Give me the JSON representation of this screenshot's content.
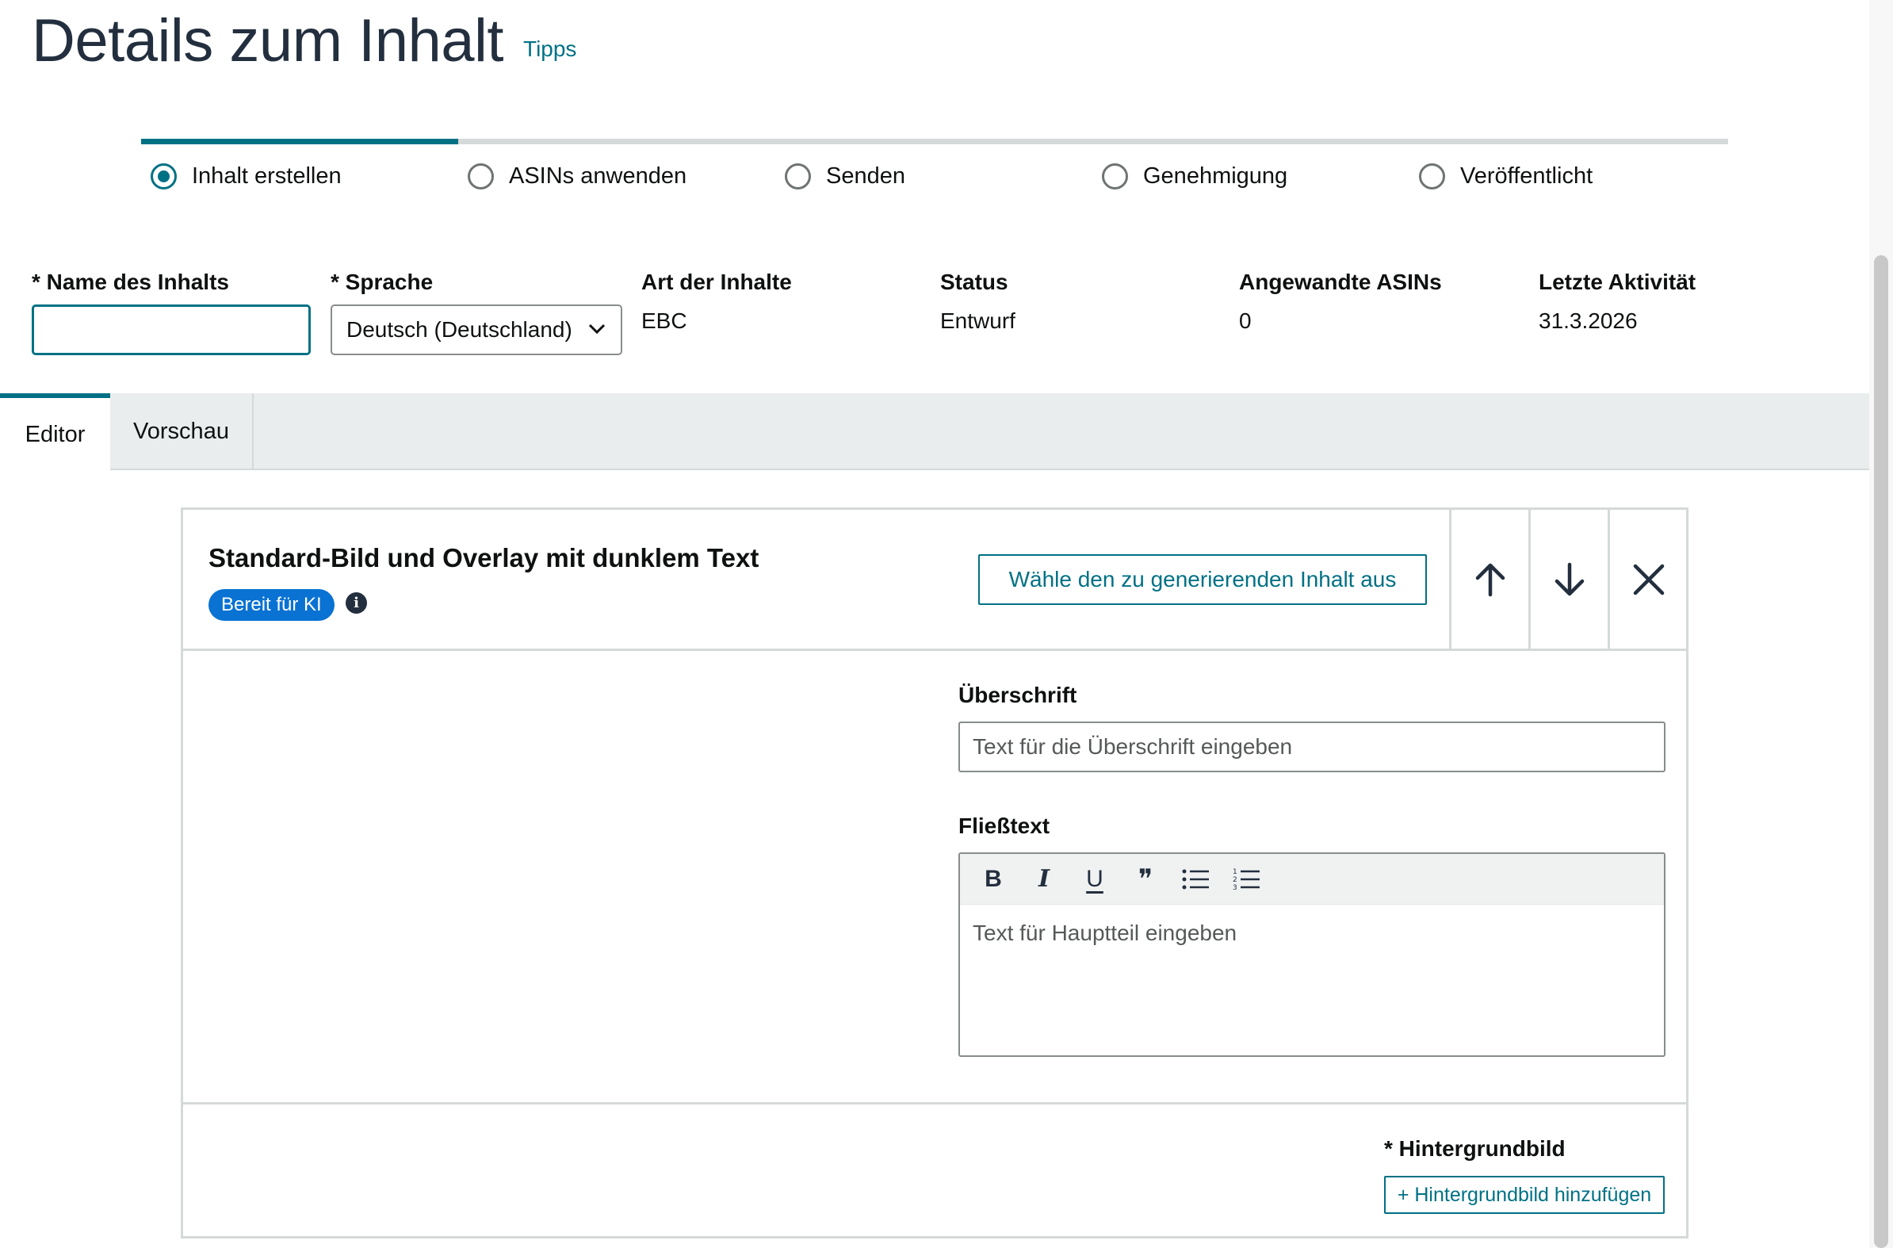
{
  "header": {
    "title": "Details zum Inhalt",
    "tips_link": "Tipps"
  },
  "stepper": {
    "progress": 0.2,
    "steps": [
      {
        "label": "Inhalt erstellen",
        "selected": true
      },
      {
        "label": "ASINs anwenden",
        "selected": false
      },
      {
        "label": "Senden",
        "selected": false
      },
      {
        "label": "Genehmigung",
        "selected": false
      },
      {
        "label": "Veröffentlicht",
        "selected": false
      }
    ]
  },
  "meta": {
    "name_label": "* Name des Inhalts",
    "name_value": "",
    "language_label": "* Sprache",
    "language_value": "Deutsch (Deutschland)",
    "content_type_label": "Art der Inhalte",
    "content_type_value": "EBC",
    "status_label": "Status",
    "status_value": "Entwurf",
    "asins_label": "Angewandte ASINs",
    "asins_value": "0",
    "activity_label": "Letzte Aktivität",
    "activity_value": "31.3.2026"
  },
  "tabs": [
    {
      "label": "Editor",
      "active": true
    },
    {
      "label": "Vorschau",
      "active": false
    }
  ],
  "module": {
    "title": "Standard-Bild und Overlay mit dunklem Text",
    "badge": "Bereit für KI",
    "info_icon": "i",
    "generate_button": "Wähle den zu generierenden Inhalt aus",
    "controls": [
      "arrow-up-icon",
      "arrow-down-icon",
      "close-icon"
    ],
    "headline_label": "Überschrift",
    "headline_value": "",
    "headline_placeholder": "Text für die Überschrift eingeben",
    "body_label": "Fließtext",
    "body_placeholder": "Text für Hauptteil eingeben",
    "toolbar": [
      {
        "name": "bold-icon",
        "glyph": "B"
      },
      {
        "name": "italic-icon",
        "glyph": "I"
      },
      {
        "name": "underline-icon",
        "glyph": "U"
      },
      {
        "name": "quote-icon",
        "glyph": "❞"
      },
      {
        "name": "bullet-list-icon",
        "glyph": ""
      },
      {
        "name": "numbered-list-icon",
        "glyph": ""
      }
    ],
    "background_label": "* Hintergrundbild",
    "add_background_button": "+ Hintergrundbild hinzufügen"
  },
  "colors": {
    "accent": "#007185",
    "badge": "#0972d3",
    "heading": "#232f3e",
    "border": "#d5d9d9"
  }
}
